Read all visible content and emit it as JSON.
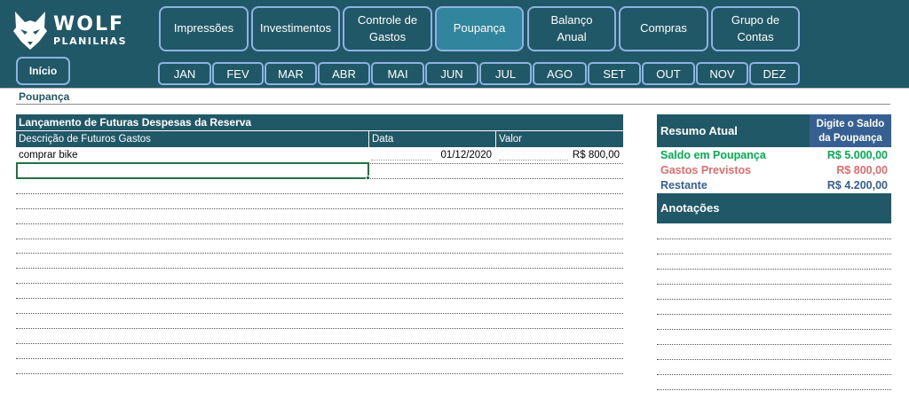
{
  "app": {
    "logo_line1": "WOLF",
    "logo_line2": "PLANILHAS"
  },
  "nav": [
    {
      "label": "Impressões"
    },
    {
      "label": "Investimentos"
    },
    {
      "label": "Controle de\nGastos"
    },
    {
      "label": "Poupança",
      "active": true
    },
    {
      "label": "Balanço\nAnual"
    },
    {
      "label": "Compras"
    },
    {
      "label": "Grupo de\nContas"
    }
  ],
  "inicio_label": "Início",
  "months": [
    "JAN",
    "FEV",
    "MAR",
    "ABR",
    "MAI",
    "JUN",
    "JUL",
    "AGO",
    "SET",
    "OUT",
    "NOV",
    "DEZ"
  ],
  "subtitle": "Poupança",
  "expenses_table": {
    "title": "Lançamento de Futuras Despesas da Reserva",
    "headers": [
      "Descrição de Futuros Gastos",
      "Data",
      "Valor"
    ],
    "rows": [
      {
        "description": "comprar bike",
        "date": "01/12/2020",
        "value": "R$ 800,00"
      }
    ]
  },
  "summary": {
    "title": "Resumo Atual",
    "note": "Digite o Saldo da Poupança",
    "items": [
      {
        "label": "Saldo em Poupança",
        "value": "R$ 5.000,00",
        "color": "#00b050"
      },
      {
        "label": "Gastos Previstos",
        "value": "R$ 800,00",
        "color": "#e26b6b"
      },
      {
        "label": "Restante",
        "value": "R$ 4.200,00",
        "color": "#366092"
      }
    ]
  },
  "notes": {
    "title": "Anotações"
  },
  "colors": {
    "brand": "#215868",
    "active_tab": "#31859c",
    "button_border": "#8db3e2",
    "note_header": "#366092"
  }
}
